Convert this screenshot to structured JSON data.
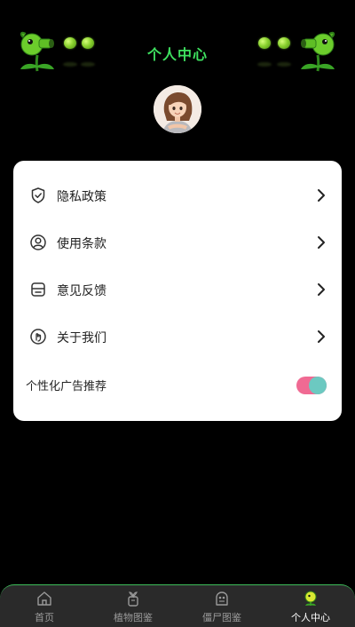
{
  "header": {
    "title": "个人中心"
  },
  "menu": {
    "items": [
      {
        "label": "隐私政策",
        "icon": "shield-icon"
      },
      {
        "label": "使用条款",
        "icon": "user-circle-icon"
      },
      {
        "label": "意见反馈",
        "icon": "feedback-box-icon"
      },
      {
        "label": "关于我们",
        "icon": "hand-touch-icon"
      }
    ],
    "ad_toggle": {
      "label": "个性化广告推荐",
      "enabled": true
    }
  },
  "tabbar": {
    "tabs": [
      {
        "label": "首页",
        "icon": "home-icon",
        "active": false
      },
      {
        "label": "植物图鉴",
        "icon": "plant-book-icon",
        "active": false
      },
      {
        "label": "僵尸图鉴",
        "icon": "zombie-book-icon",
        "active": false
      },
      {
        "label": "个人中心",
        "icon": "peashooter-profile-icon",
        "active": true
      }
    ]
  },
  "colors": {
    "background": "#000000",
    "title": "#3ee05f",
    "card": "#ffffff",
    "toggle_track": "#f06a93",
    "toggle_knob": "#6cc9c1",
    "tabbar": "#2a2a2a",
    "tabbar_border": "#3dbd5a"
  }
}
